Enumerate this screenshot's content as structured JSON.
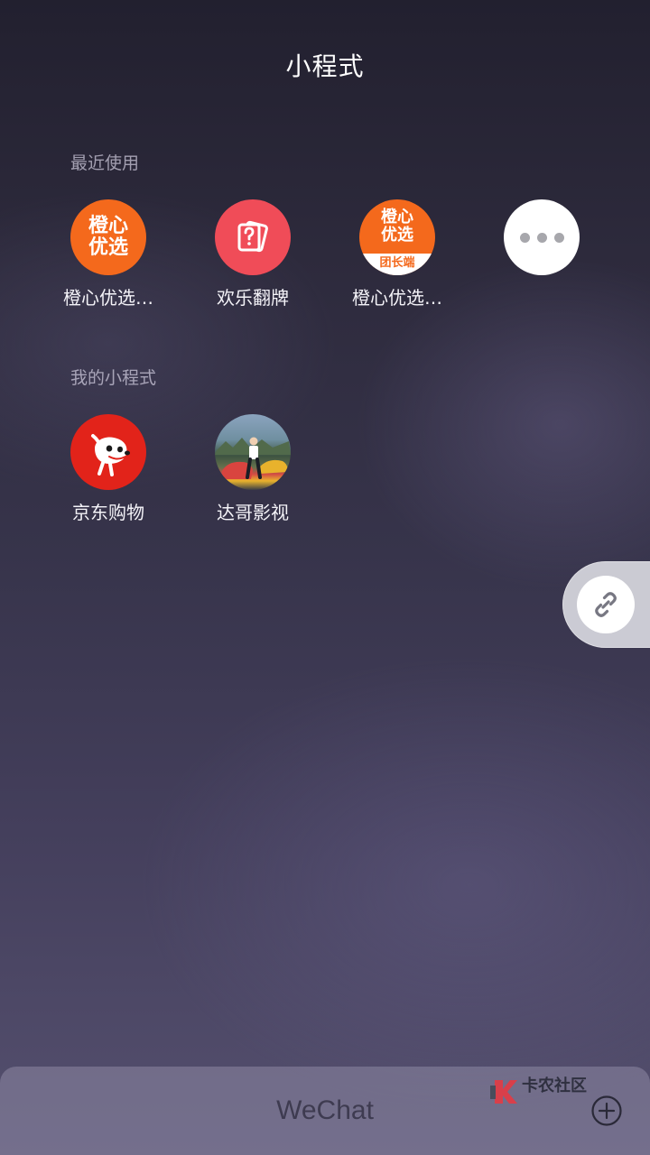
{
  "header": {
    "title": "小程式"
  },
  "sections": {
    "recent": {
      "label": "最近使用",
      "items": [
        {
          "name": "橙心优选…",
          "icon": "cheng-xin-you-xuan-icon",
          "icon_text_line1": "橙心",
          "icon_text_line2": "优选",
          "icon_color": "#f4691c"
        },
        {
          "name": "欢乐翻牌",
          "icon": "card-flip-icon",
          "icon_color": "#f04c58"
        },
        {
          "name": "橙心优选…",
          "icon": "cheng-xin-team-icon",
          "icon_text_line1": "橙心",
          "icon_text_line2": "优选",
          "badge_text": "团长端",
          "icon_color": "#f4691c"
        },
        {
          "icon": "more-icon",
          "icon_color": "#ffffff"
        }
      ]
    },
    "mine": {
      "label": "我的小程式",
      "items": [
        {
          "name": "京东购物",
          "icon": "jd-dog-icon",
          "icon_color": "#e2231a"
        },
        {
          "name": "达哥影视",
          "icon": "photo-avatar-icon"
        }
      ]
    }
  },
  "floating": {
    "icon": "link-icon"
  },
  "bottom_bar": {
    "title": "WeChat",
    "watermark_text": "卡农社区",
    "plus_icon": "plus-circle-icon"
  }
}
